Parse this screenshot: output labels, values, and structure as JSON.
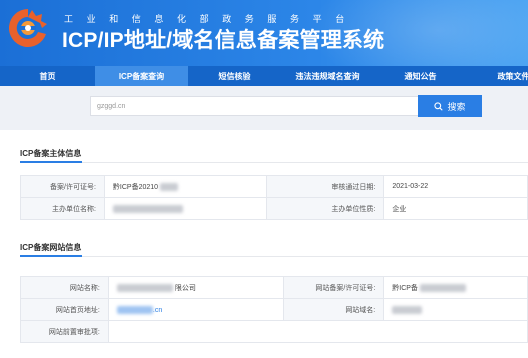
{
  "header": {
    "subtitle": "工业和信息化部政务服务平台",
    "title": "ICP/IP地址/域名信息备案管理系统",
    "colors": {
      "primary": "#1b6fd6",
      "logo_orange": "#e8612c"
    }
  },
  "nav": {
    "items": [
      {
        "label": "首页"
      },
      {
        "label": "ICP备案查询"
      },
      {
        "label": "短信核验"
      },
      {
        "label": "违法违规域名查询"
      },
      {
        "label": "通知公告"
      },
      {
        "label": "政策文件"
      }
    ],
    "active_index": 1
  },
  "search": {
    "value": "gzggd.cn",
    "button_label": "搜索",
    "icon": "search-icon"
  },
  "subject_section": {
    "title": "ICP备案主体信息",
    "rows": [
      {
        "label1": "备案/许可证号:",
        "value1": "黔ICP备20210",
        "label2": "审核通过日期:",
        "value2": "2021-03-22"
      },
      {
        "label1": "主办单位名称:",
        "value1": "",
        "label2": "主办单位性质:",
        "value2": "企业"
      }
    ]
  },
  "site_section": {
    "title": "ICP备案网站信息",
    "rows": [
      {
        "label1": "网站名称:",
        "value1": "限公司",
        "label2": "网站备案/许可证号:",
        "value2": "黔ICP备"
      },
      {
        "label1": "网站首页地址:",
        "value1": ".cn",
        "label2": "网站域名:",
        "value2": ""
      },
      {
        "label1": "网站前置审批项:",
        "value1": ""
      }
    ]
  }
}
